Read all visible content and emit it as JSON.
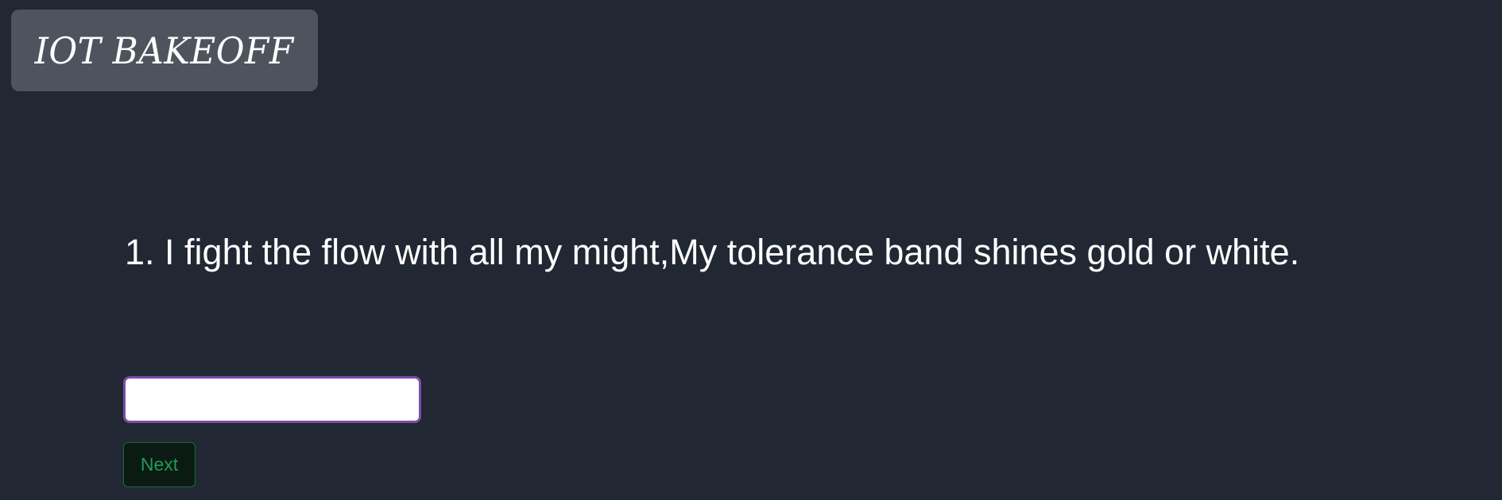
{
  "header": {
    "logo_text": "IOT BAKEOFF"
  },
  "question": {
    "text": "1. I fight the flow with all my might,My tolerance band shines gold or white."
  },
  "answer": {
    "value": "",
    "placeholder": ""
  },
  "actions": {
    "next_label": "Next"
  },
  "colors": {
    "background": "#212733",
    "logo_background": "#4e545e",
    "input_border": "#7b4ea8",
    "next_text": "#1f9d55",
    "next_border": "#1e6b3e",
    "next_background": "#0b1a12"
  }
}
